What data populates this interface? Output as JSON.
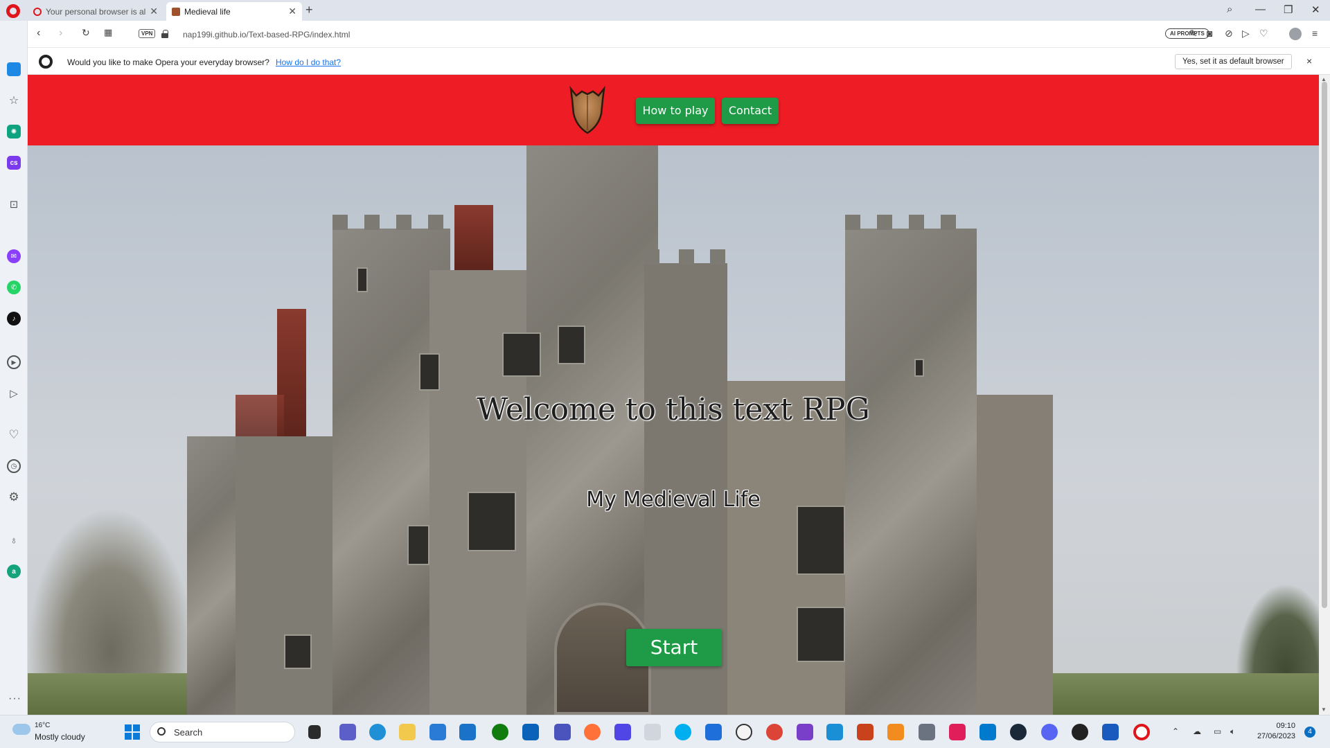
{
  "browser": {
    "tabs": [
      {
        "title": "Your personal browser is al",
        "active": false
      },
      {
        "title": "Medieval life",
        "active": true
      }
    ],
    "new_tab": "+",
    "url": "nap199i.github.io/Text-based-RPG/index.html",
    "vpn_label": "VPN",
    "ai_prompts_label": "AI PROMPTS",
    "infobar": {
      "message": "Would you like to make Opera your everyday browser?",
      "link": "How do I do that?",
      "button": "Yes, set it as default browser",
      "close": "×"
    }
  },
  "site": {
    "nav": {
      "how_to_play": "How to play",
      "contact": "Contact"
    },
    "title": "Welcome to this text RPG",
    "subtitle": "My Medieval Life",
    "start_button": "Start"
  },
  "taskbar": {
    "weather_temp": "16°C",
    "weather_desc": "Mostly cloudy",
    "search_placeholder": "Search",
    "time": "09:10",
    "date": "27/06/2023",
    "notifications": "4"
  },
  "colors": {
    "header": "#ee1c25",
    "button": "#1f9a46",
    "opera_red": "#e0141b"
  }
}
